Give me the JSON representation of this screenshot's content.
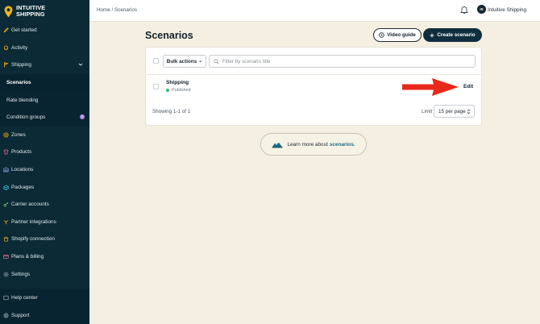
{
  "brand": {
    "line1": "INTUITIVE",
    "line2": "SHIPPING",
    "accent": "#f2b51b"
  },
  "sidebar": {
    "items": [
      {
        "label": "Get started",
        "icon": "rocket-icon"
      },
      {
        "label": "Activity",
        "icon": "bell-icon"
      },
      {
        "label": "Shipping",
        "icon": "flag-icon"
      },
      {
        "label": "Scenarios",
        "icon": ""
      },
      {
        "label": "Rate blending",
        "icon": ""
      },
      {
        "label": "Condition groups",
        "icon": ""
      },
      {
        "label": "Zones",
        "icon": "zones-icon"
      },
      {
        "label": "Products",
        "icon": "shirt-icon"
      },
      {
        "label": "Locations",
        "icon": "warehouse-icon"
      },
      {
        "label": "Packages",
        "icon": "box-icon"
      },
      {
        "label": "Carrier accounts",
        "icon": "key-icon"
      },
      {
        "label": "Partner integrations",
        "icon": "integrations-icon"
      },
      {
        "label": "Shopify connection",
        "icon": "shopify-icon"
      },
      {
        "label": "Plans & billing",
        "icon": "card-icon"
      },
      {
        "label": "Settings",
        "icon": "gear-icon"
      }
    ],
    "condition_badge": "!",
    "bottom": [
      {
        "label": "Help center",
        "icon": "help-icon"
      },
      {
        "label": "Support",
        "icon": "support-icon"
      }
    ]
  },
  "topbar": {
    "breadcrumb_home": "Home",
    "breadcrumb_sep": "/",
    "breadcrumb_current": "Scenarios",
    "avatar_initials": "IS",
    "org_name": "Intuitive Shipping"
  },
  "page": {
    "title": "Scenarios",
    "video_guide": "Video guide",
    "create_scenario": "Create scenario"
  },
  "table": {
    "bulk_actions": "Bulk actions",
    "filter_placeholder": "Filter by scenario title",
    "rows": [
      {
        "title": "Shipping",
        "status": "Published",
        "action": "Edit"
      }
    ],
    "showing": "Showing 1-1 of 1",
    "limit_label": "Limit",
    "limit_value": "15 per page"
  },
  "learn": {
    "text": "Learn more about",
    "link": "scenarios."
  },
  "colors": {
    "sidebar_bg": "#0b2a36",
    "page_bg": "#f5efe1",
    "primary_btn": "#0f2e3d",
    "arrow": "#e8281a",
    "status_green": "#35b36b"
  }
}
